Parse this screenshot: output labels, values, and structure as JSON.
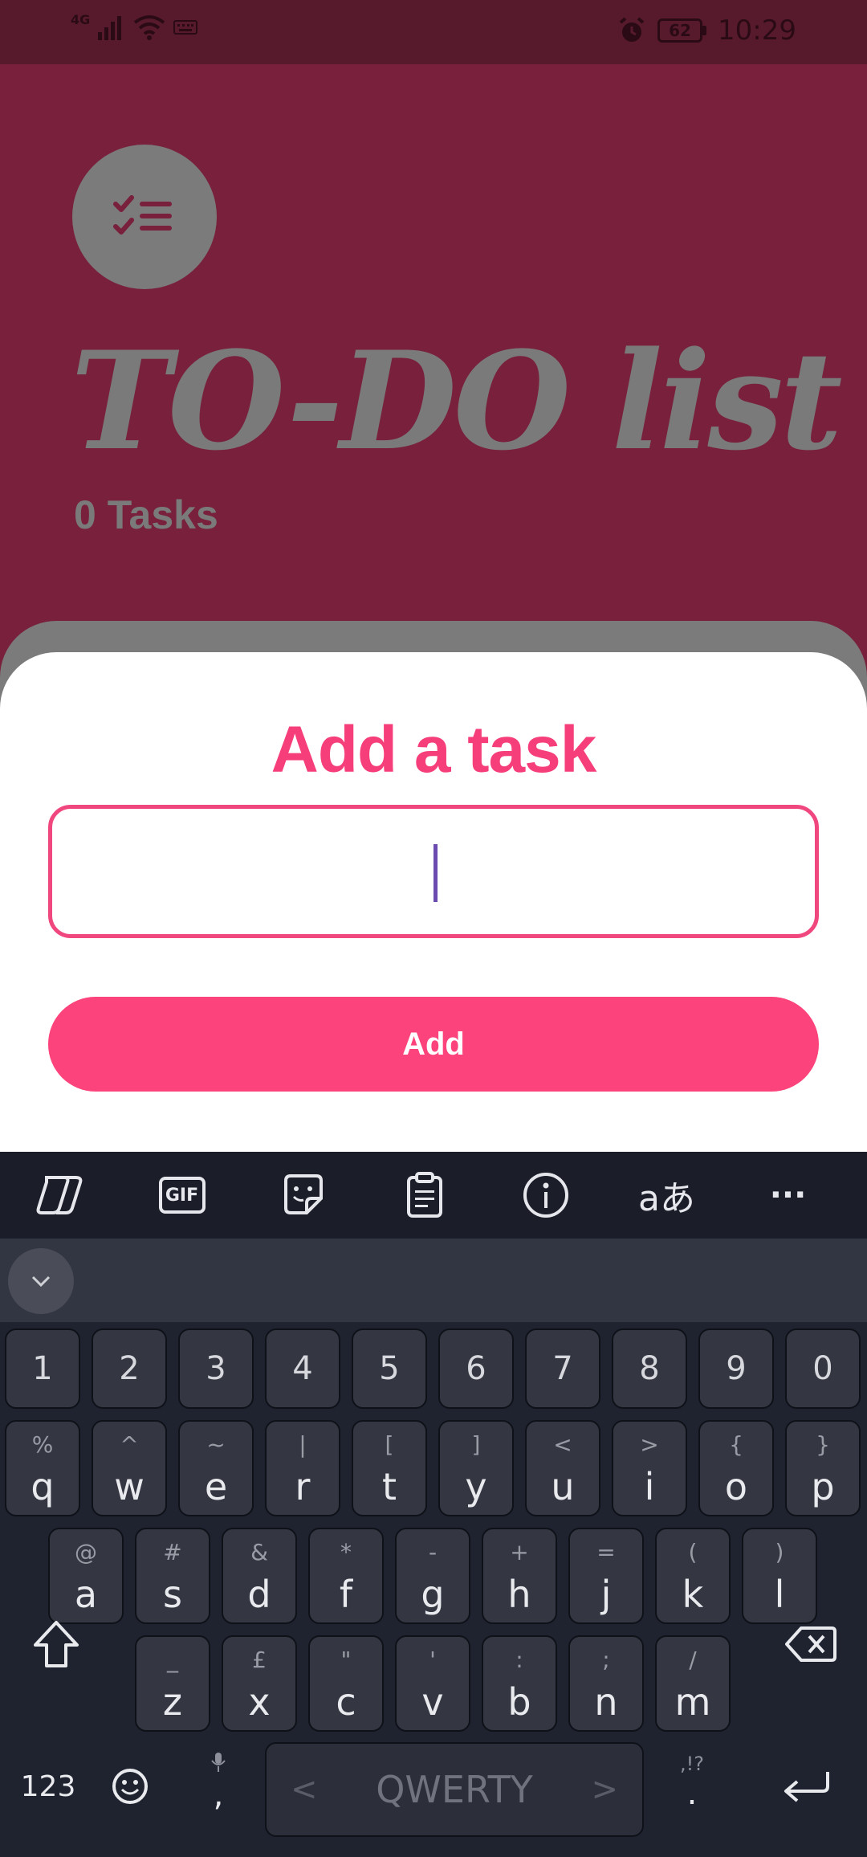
{
  "status_bar": {
    "network": "4G",
    "battery": "62",
    "time": "10:29"
  },
  "header": {
    "title": "TO-DO list",
    "task_count": "0 Tasks"
  },
  "sheet": {
    "title": "Add a task",
    "input_value": "",
    "add_label": "Add"
  },
  "keyboard": {
    "number_row": [
      "1",
      "2",
      "3",
      "4",
      "5",
      "6",
      "7",
      "8",
      "9",
      "0"
    ],
    "row1": [
      {
        "key": "q",
        "hint": "%"
      },
      {
        "key": "w",
        "hint": "^"
      },
      {
        "key": "e",
        "hint": "~"
      },
      {
        "key": "r",
        "hint": "|"
      },
      {
        "key": "t",
        "hint": "["
      },
      {
        "key": "y",
        "hint": "]"
      },
      {
        "key": "u",
        "hint": "<"
      },
      {
        "key": "i",
        "hint": ">"
      },
      {
        "key": "o",
        "hint": "{"
      },
      {
        "key": "p",
        "hint": "}"
      }
    ],
    "row2": [
      {
        "key": "a",
        "hint": "@"
      },
      {
        "key": "s",
        "hint": "#"
      },
      {
        "key": "d",
        "hint": "&"
      },
      {
        "key": "f",
        "hint": "*"
      },
      {
        "key": "g",
        "hint": "-"
      },
      {
        "key": "h",
        "hint": "+"
      },
      {
        "key": "j",
        "hint": "="
      },
      {
        "key": "k",
        "hint": "("
      },
      {
        "key": "l",
        "hint": ")"
      }
    ],
    "row3": [
      {
        "key": "z",
        "hint": "_"
      },
      {
        "key": "x",
        "hint": "£"
      },
      {
        "key": "c",
        "hint": "\""
      },
      {
        "key": "v",
        "hint": "'"
      },
      {
        "key": "b",
        "hint": ":"
      },
      {
        "key": "n",
        "hint": ";"
      },
      {
        "key": "m",
        "hint": "/"
      }
    ],
    "numbers_switch": "123",
    "comma": ",",
    "space_label": "QWERTY",
    "period": ".",
    "period_hint": ",!?",
    "toolbar": [
      "copilot-icon",
      "gif-icon",
      "sticker-icon",
      "clipboard-icon",
      "info-icon",
      "translate-icon",
      "more-icon"
    ],
    "gif_label": "GIF",
    "translate_label": "aあ",
    "more_label": "···"
  },
  "colors": {
    "accent": "#fc437c",
    "header_bg": "#78203c",
    "keyboard_bg": "#1f2330"
  }
}
